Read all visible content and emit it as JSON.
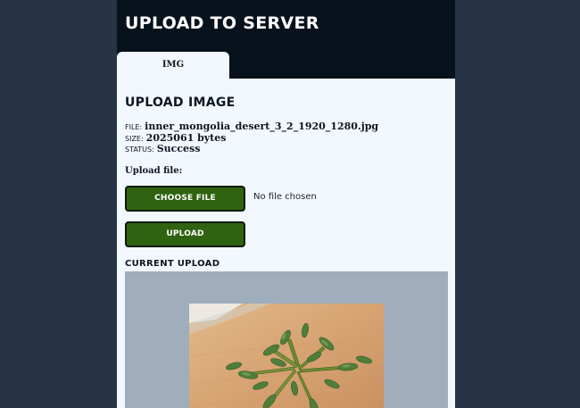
{
  "header": {
    "title": "UPLOAD TO SERVER"
  },
  "tabs": [
    {
      "label": "IMG"
    }
  ],
  "main": {
    "section_title": "UPLOAD IMAGE",
    "file_info": {
      "file_key": "FILE:",
      "file_value": "inner_mongolia_desert_3_2_1920_1280.jpg",
      "size_key": "SIZE:",
      "size_value": "2025061 bytes",
      "status_key": "STATUS:",
      "status_value": "Success"
    },
    "upload_label": "Upload file:",
    "choose_file_label": "CHOOSE FILE",
    "no_file_text": "No file chosen",
    "upload_button_label": "UPLOAD",
    "current_upload_title": "CURRENT UPLOAD"
  },
  "colors": {
    "background": "#263445",
    "header": "#08121d",
    "panel": "#f2f8fd",
    "button": "#306311",
    "preview_bg": "#9fadbc"
  },
  "icons": {
    "preview_image": "plant-on-sand-photo"
  }
}
